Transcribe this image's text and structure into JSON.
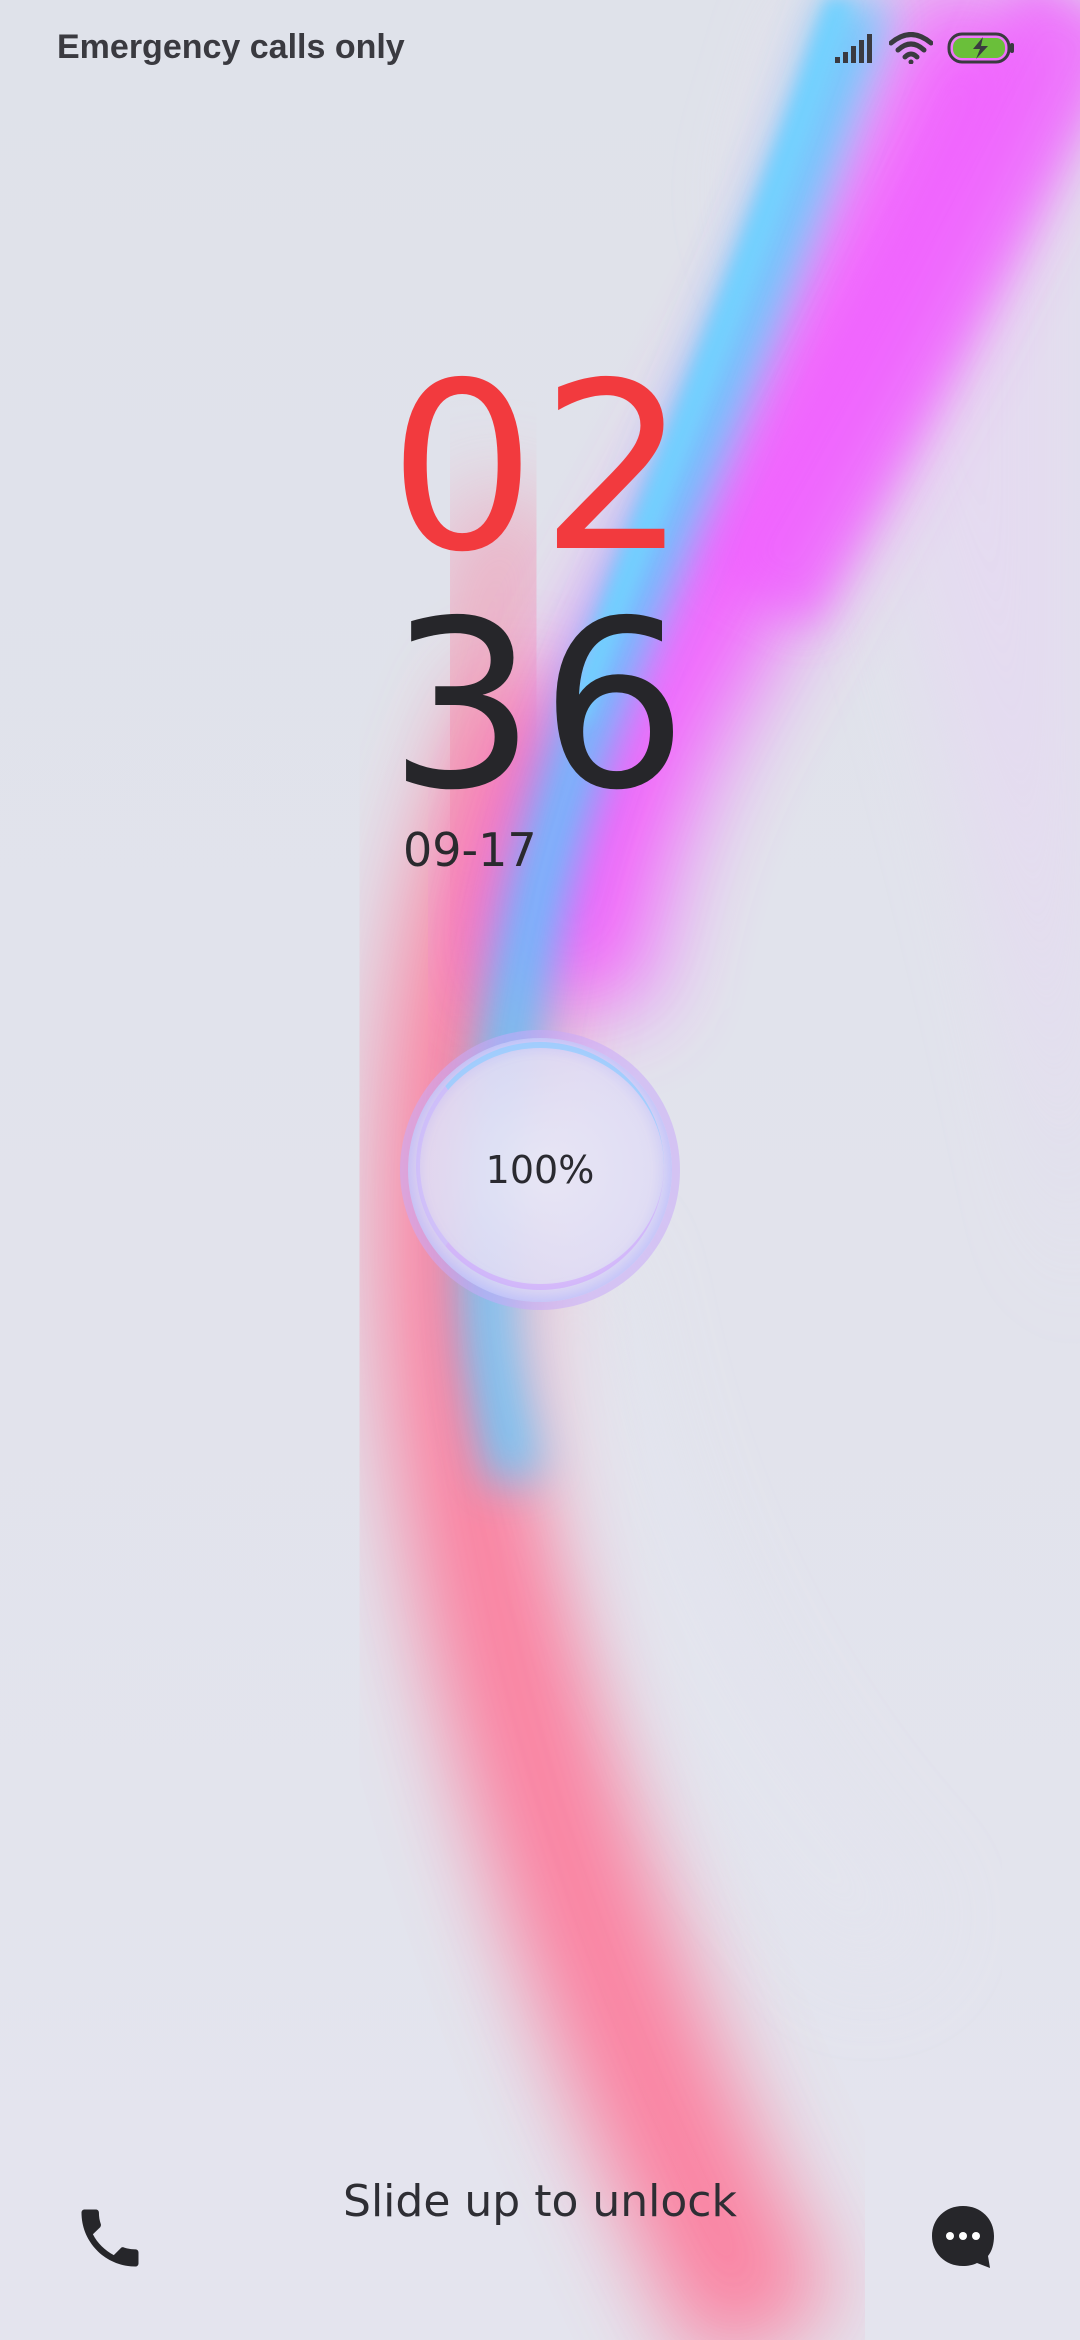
{
  "status_bar": {
    "carrier_text": "Emergency calls only",
    "icons": [
      "signal-icon",
      "wifi-icon",
      "battery-charging-icon"
    ],
    "battery_fill_color": "#6abf3a"
  },
  "clock": {
    "hours": "02",
    "minutes": "36",
    "hours_color": "#f23a3e",
    "minutes_color": "#26262a"
  },
  "date": "09-17",
  "battery": {
    "percent_label": "100%",
    "level": 1.0
  },
  "unlock_hint": "Slide up to unlock",
  "shortcuts": {
    "left": "phone-icon",
    "right": "message-icon"
  },
  "wallpaper": {
    "colors": [
      "#e4e4ec",
      "#ff6b8f",
      "#5fc6ff",
      "#f15cff"
    ]
  }
}
